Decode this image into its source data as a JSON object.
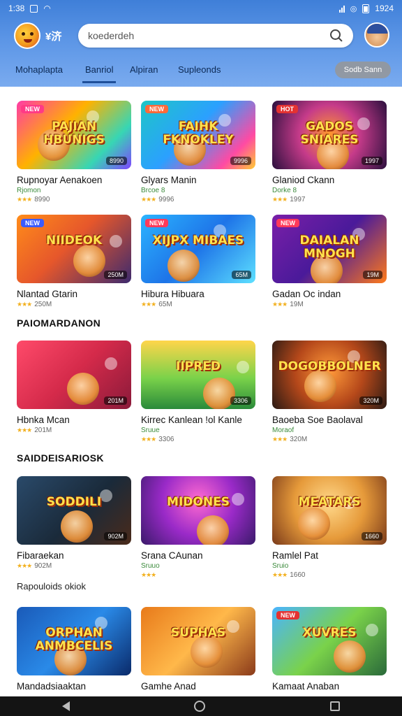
{
  "status_bar": {
    "time": "1:38",
    "battery": "1924"
  },
  "app": {
    "name": "¥济"
  },
  "search": {
    "value": "koederdeh"
  },
  "tabs": [
    {
      "label": "Mohaplapta",
      "active": false
    },
    {
      "label": "Banriol",
      "active": true
    },
    {
      "label": "Alpiran",
      "active": false
    },
    {
      "label": "Supleonds",
      "active": false
    }
  ],
  "action_button": {
    "label": "Sodb Sann"
  },
  "sections": {
    "s2": {
      "title": "PAIOMARDANON"
    },
    "s3": {
      "title": "SAIDDEISARIOSK"
    },
    "extra": "Rapouloids okiok"
  },
  "colors": {
    "header_top": "#3f7fd8",
    "accent": "#1f4f99"
  },
  "cards": [
    {
      "name": "Rupnoyar Aenakoen",
      "sub": "Rjomon",
      "rating": "★★★",
      "size": "8990",
      "art_title": "PAJIAN HBUNIGS",
      "badge": "NEW",
      "badge_color": "#ff3a86",
      "bg": "linear-gradient(135deg,#ff3aa7 0%,#ffb200 40%,#37d6b4 75%,#7e45ff 100%)"
    },
    {
      "name": "Glyars Manin",
      "sub": "Brcoe 8",
      "rating": "★★★",
      "size": "9996",
      "art_title": "FAIHK FKNOKLEY",
      "badge": "NEW",
      "badge_color": "#ff6a3a",
      "bg": "linear-gradient(135deg,#1ec6c6 0%,#2ba0ff 45%,#ff4aa3 80%,#ffcb33 100%)"
    },
    {
      "name": "Glaniod Ckann",
      "sub": "Dorke 8",
      "rating": "★★★",
      "size": "1997",
      "art_title": "GADOS SNIARES",
      "badge": "HOT",
      "badge_color": "#e43232",
      "bg": "radial-gradient(circle at 50% 50%,#ff9a2a 0%,#c63b8a 45%,#2a0f3d 100%)"
    },
    {
      "name": "Nlantad Gtarin",
      "sub": "",
      "rating": "★★★",
      "size": "250M",
      "art_title": "NIIDEOK",
      "badge": "NEW",
      "badge_color": "#3a5bff",
      "bg": "linear-gradient(135deg,#ff8c1a 0%,#e6572b 45%,#3c2a6e 100%)"
    },
    {
      "name": "Hibura Hibuara",
      "sub": "",
      "rating": "★★★",
      "size": "65M",
      "art_title": "XIJPX MIBAES",
      "badge": "NEW",
      "badge_color": "#ff3a5a",
      "bg": "linear-gradient(135deg,#2bb4ff 0%,#1e74e8 50%,#5de0ff 100%)"
    },
    {
      "name": "Gadan Oc indan",
      "sub": "",
      "rating": "★★★",
      "size": "19M",
      "art_title": "DAIALAN MNOGH",
      "badge": "NEW",
      "badge_color": "#ff3a5a",
      "bg": "linear-gradient(135deg,#7a1fa8 0%,#4a1a9a 50%,#ff7a1a 100%)"
    },
    {
      "name": "Hbnka Mcan",
      "sub": "",
      "rating": "★★★",
      "size": "201M",
      "art_title": "",
      "badge": "",
      "badge_color": "#000000",
      "bg": "linear-gradient(135deg,#ff4a6a 0%,#d42a4a 50%,#8a1a3a 100%)"
    },
    {
      "name": "Kirrec Kanlean !ol Kanle",
      "sub": "Sruue",
      "rating": "★★★",
      "size": "3306",
      "art_title": "IIPRED",
      "badge": "",
      "badge_color": "#000000",
      "bg": "linear-gradient(180deg,#ffd54a 0%,#7ad24a 55%,#2a8a3a 100%)"
    },
    {
      "name": "Baoeba Soe Baolaval",
      "sub": "Moraof",
      "rating": "★★★",
      "size": "320M",
      "art_title": "DOGOBBOLNER",
      "badge": "",
      "badge_color": "#000000",
      "bg": "radial-gradient(circle at 50% 45%,#ff9a3a 0%,#b5481a 50%,#2a1a14 100%)"
    },
    {
      "name": "Fibaraekan",
      "sub": "",
      "rating": "★★★",
      "size": "902M",
      "art_title": "SODDILI",
      "badge": "",
      "badge_color": "#000000",
      "bg": "linear-gradient(135deg,#2a4a6a 0%,#1a2a3a 55%,#4a2a1a 100%)"
    },
    {
      "name": "Srana CAunan",
      "sub": "Sruuo",
      "rating": "★★★",
      "size": "",
      "art_title": "MIDONES",
      "badge": "",
      "badge_color": "#000000",
      "bg": "radial-gradient(circle at 50% 35%,#ff6ad0 0%,#9a2ac8 50%,#3a1a6a 100%)"
    },
    {
      "name": "Ramlel Pat",
      "sub": "Sruio",
      "rating": "★★★",
      "size": "1660",
      "art_title": "MEATARS",
      "badge": "",
      "badge_color": "#000000",
      "bg": "radial-gradient(circle at 50% 40%,#ffd88a 0%,#e69a3a 50%,#7a3a1a 100%)"
    },
    {
      "name": "Mandadsiaaktan",
      "sub": "",
      "rating": "",
      "size": "",
      "art_title": "ORPHAN ANMBCELIS",
      "badge": "",
      "badge_color": "#000000",
      "bg": "linear-gradient(135deg,#1a5ab8 0%,#2a8ae8 50%,#0a2a6a 100%)"
    },
    {
      "name": "Gamhe Anad",
      "sub": "",
      "rating": "",
      "size": "",
      "art_title": "SUPHAS",
      "badge": "",
      "badge_color": "#000000",
      "bg": "linear-gradient(135deg,#e87a1a 0%,#ffb84a 50%,#8a3a1a 100%)"
    },
    {
      "name": "Kamaat Anaban",
      "sub": "",
      "rating": "",
      "size": "",
      "art_title": "XUVRES",
      "badge": "NEW",
      "badge_color": "#e43232",
      "bg": "linear-gradient(135deg,#4ab4ff 0%,#7ad24a 50%,#2a6a3a 100%)"
    }
  ]
}
